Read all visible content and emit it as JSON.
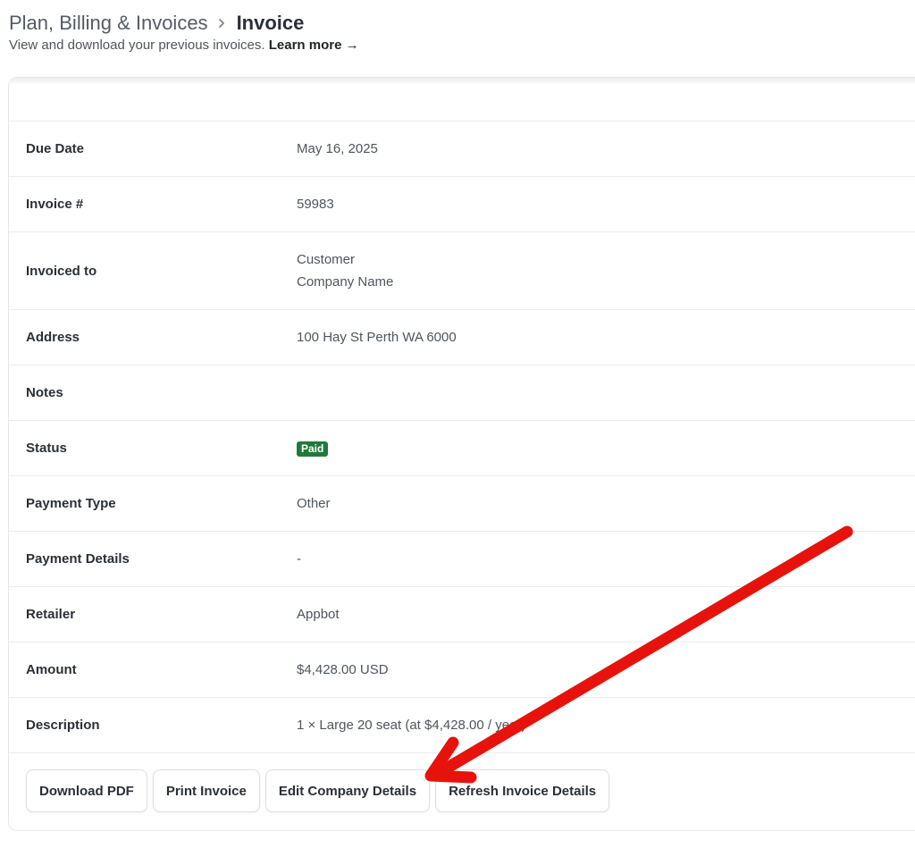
{
  "header": {
    "breadcrumb_parent": "Plan, Billing & Invoices",
    "breadcrumb_current": "Invoice",
    "subtitle": "View and download your previous invoices.",
    "learn_more": "Learn more →"
  },
  "invoice": {
    "rows": [
      {
        "label": "Due Date",
        "value": "May 16, 2025"
      },
      {
        "label": "Invoice #",
        "value": "59983"
      },
      {
        "label": "Invoiced to",
        "value_line1": "Customer",
        "value_line2": "Company Name"
      },
      {
        "label": "Address",
        "value": "100 Hay St Perth WA 6000"
      },
      {
        "label": "Notes",
        "value": ""
      },
      {
        "label": "Status",
        "badge": "Paid"
      },
      {
        "label": "Payment Type",
        "value": "Other"
      },
      {
        "label": "Payment Details",
        "value": "-"
      },
      {
        "label": "Retailer",
        "value": "Appbot"
      },
      {
        "label": "Amount",
        "value": "$4,428.00 USD"
      },
      {
        "label": "Description",
        "value": "1 × Large 20 seat (at $4,428.00 / year)"
      }
    ]
  },
  "actions": {
    "download_pdf": "Download PDF",
    "print_invoice": "Print Invoice",
    "edit_company_details": "Edit Company Details",
    "refresh_invoice_details": "Refresh Invoice Details"
  },
  "colors": {
    "paid_badge": "#1f7a3a",
    "annotation_arrow": "#e8120c"
  },
  "icons": {
    "breadcrumb_separator": "chevron-right-icon"
  }
}
